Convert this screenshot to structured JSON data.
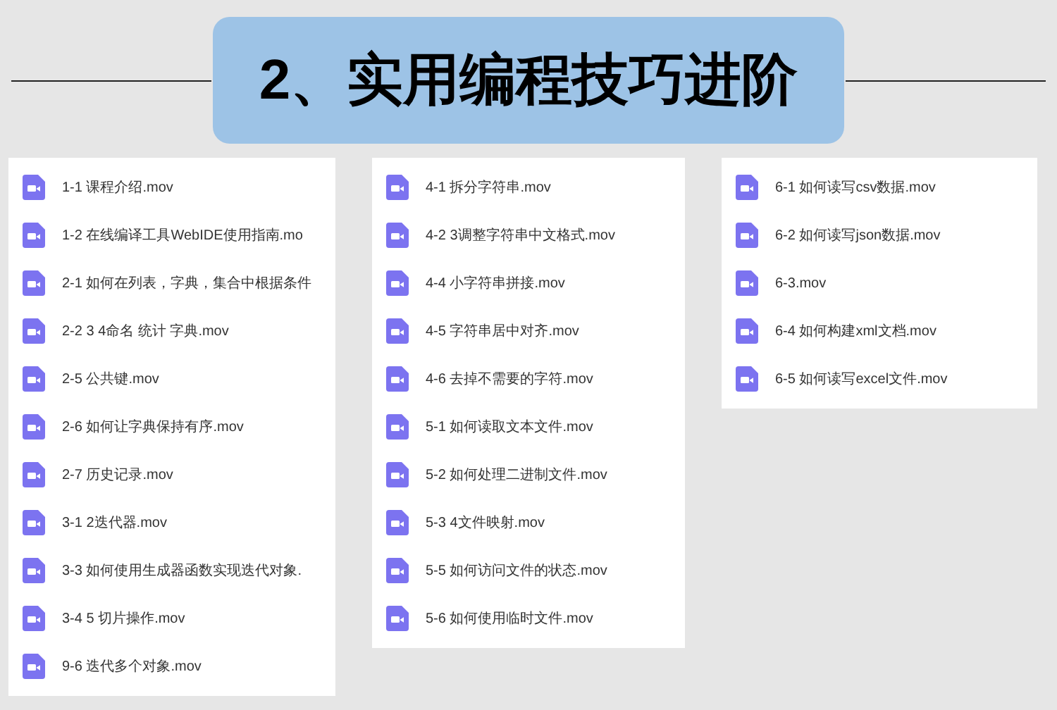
{
  "title": "2、实用编程技巧进阶",
  "panels": [
    {
      "files": [
        "1-1 课程介绍.mov",
        "1-2 在线编译工具WebIDE使用指南.mo",
        "2-1 如何在列表，字典，集合中根据条件",
        "2-2 3 4命名  统计  字典.mov",
        "2-5 公共键.mov",
        "2-6 如何让字典保持有序.mov",
        "2-7 历史记录.mov",
        "3-1 2迭代器.mov",
        "3-3 如何使用生成器函数实现迭代对象.",
        "3-4 5 切片操作.mov",
        "9-6 迭代多个对象.mov"
      ]
    },
    {
      "files": [
        "4-1 拆分字符串.mov",
        "4-2 3调整字符串中文格式.mov",
        "4-4 小字符串拼接.mov",
        "4-5 字符串居中对齐.mov",
        "4-6 去掉不需要的字符.mov",
        "5-1 如何读取文本文件.mov",
        "5-2 如何处理二进制文件.mov",
        "5-3 4文件映射.mov",
        "5-5 如何访问文件的状态.mov",
        "5-6 如何使用临时文件.mov"
      ]
    },
    {
      "files": [
        "6-1 如何读写csv数据.mov",
        "6-2 如何读写json数据.mov",
        "6-3.mov",
        "6-4 如何构建xml文档.mov",
        "6-5 如何读写excel文件.mov"
      ]
    }
  ]
}
